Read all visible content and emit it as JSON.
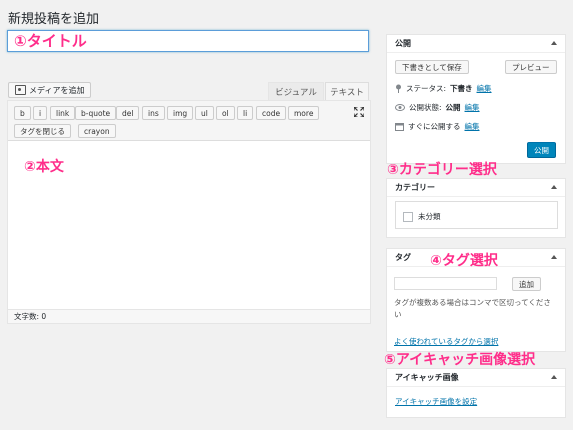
{
  "page": {
    "title": "新規投稿を追加"
  },
  "title_field": {
    "placeholder": "①タイトル"
  },
  "editor": {
    "media_button": "メディアを追加",
    "tabs": {
      "visual": "ビジュアル",
      "text": "テキスト"
    },
    "quicktags_row1": [
      "b",
      "i",
      "link",
      "b-quote",
      "del",
      "ins",
      "img",
      "ul",
      "ol",
      "li",
      "code",
      "more"
    ],
    "quicktags_row2": [
      "タグを閉じる",
      "crayon"
    ],
    "annotation": "②本文",
    "word_count": "文字数: 0"
  },
  "publish_box": {
    "heading": "公開",
    "save_draft": "下書きとして保存",
    "preview": "プレビュー",
    "status_label": "ステータス:",
    "status_value": "下書き",
    "status_edit": "編集",
    "visibility_label": "公開状態:",
    "visibility_value": "公開",
    "visibility_edit": "編集",
    "schedule_label": "すぐに公開する",
    "schedule_edit": "編集",
    "publish_button": "公開"
  },
  "category_box": {
    "annotation": "③カテゴリー選択",
    "heading": "カテゴリー",
    "items": [
      "未分類"
    ]
  },
  "tag_box": {
    "heading": "タグ",
    "annotation": "④タグ選択",
    "add_button": "追加",
    "help_text": "タグが複数ある場合はコンマで区切ってください",
    "choose_link": "よく使われているタグから選択"
  },
  "thumbnail_box": {
    "annotation": "⑤アイキャッチ画像選択",
    "heading": "アイキャッチ画像",
    "set_link": "アイキャッチ画像を設定"
  },
  "colors": {
    "annotation": "#ff2d8a",
    "link": "#0073aa",
    "primary": "#0085ba"
  }
}
